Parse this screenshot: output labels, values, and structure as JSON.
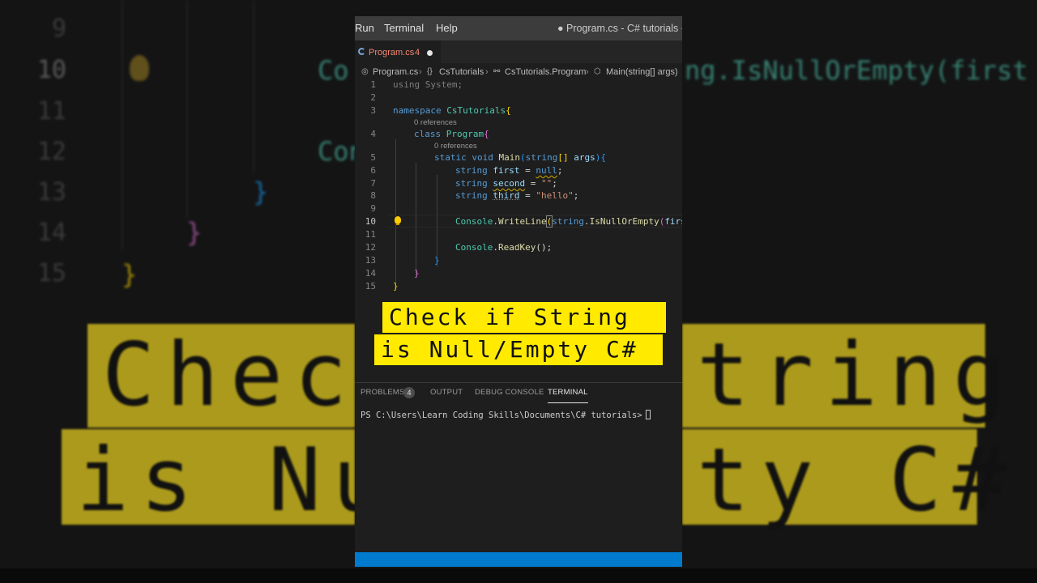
{
  "menubar": {
    "items": [
      "Run",
      "Terminal",
      "Help"
    ],
    "window_title": "● Program.cs - C# tutorials - V"
  },
  "tab": {
    "filename": "Program.cs",
    "problem_count": "4"
  },
  "breadcrumb": {
    "file": "Program.cs",
    "namespace": "CsTutorials",
    "class": "CsTutorials.Program",
    "method": "Main(string[] args)"
  },
  "editor": {
    "line_numbers": [
      "1",
      "2",
      "3",
      "4",
      "5",
      "6",
      "7",
      "8",
      "9",
      "10",
      "11",
      "12",
      "13",
      "14",
      "15"
    ],
    "current_line": "10",
    "codelens": [
      "0 references",
      "0 references"
    ],
    "tokens": {
      "using": "using",
      "system": "System",
      "semi": ";",
      "namespace": "namespace",
      "ns_name": "CsTutorials",
      "brace_open": "{",
      "brace_close": "}",
      "class": "class",
      "class_name": "Program",
      "static": "static",
      "void": "void",
      "main": "Main",
      "paren_open": "(",
      "paren_close": ")",
      "string": "string",
      "brackets": "[]",
      "args": "args",
      "first": "first",
      "second": "second",
      "third": "third",
      "eq": " = ",
      "null": "null",
      "empty_str": "\"\"",
      "hello_str": "\"hello\"",
      "console": "Console",
      "dot": ".",
      "writeline": "WriteLine",
      "isnull": "IsNullOrEmpty",
      "readkey": "ReadKey",
      "empty_parens": "()"
    }
  },
  "overlay": {
    "line1": "Check if String",
    "line2": "is Null/Empty C#"
  },
  "background_echo": {
    "line_numbers": [
      "9",
      "10",
      "11",
      "12",
      "13",
      "14",
      "15"
    ],
    "code_line10_left": "Co",
    "code_line10_right": "ng.IsNullOrEmpty(first",
    "code_line12_left": "Con",
    "brace_blue": "}",
    "brace_pink": "}",
    "brace_gold": "}",
    "banner_line1_left": "Check",
    "banner_line1_right": "tring",
    "banner_line2_left": "is Nu",
    "banner_line2_right": "ty C#"
  },
  "panel": {
    "tabs": [
      "PROBLEMS",
      "OUTPUT",
      "DEBUG CONSOLE",
      "TERMINAL"
    ],
    "problems_badge": "4",
    "active_tab": "TERMINAL",
    "prompt": "PS C:\\Users\\Learn Coding Skills\\Documents\\C# tutorials>"
  },
  "colors": {
    "editor_bg": "#1e1e1e",
    "menubar_bg": "#3c3c3c",
    "statusbar_bg": "#007acc",
    "banner_yellow": "#ffea00",
    "keyword": "#569cd6",
    "type": "#4ec9b0",
    "string_literal": "#ce9178",
    "method": "#dcdcaa",
    "variable": "#9cdcfe"
  },
  "icons": [
    "lightbulb-icon",
    "csharp-file-icon",
    "braces-icon",
    "class-icon",
    "method-cube-icon"
  ]
}
